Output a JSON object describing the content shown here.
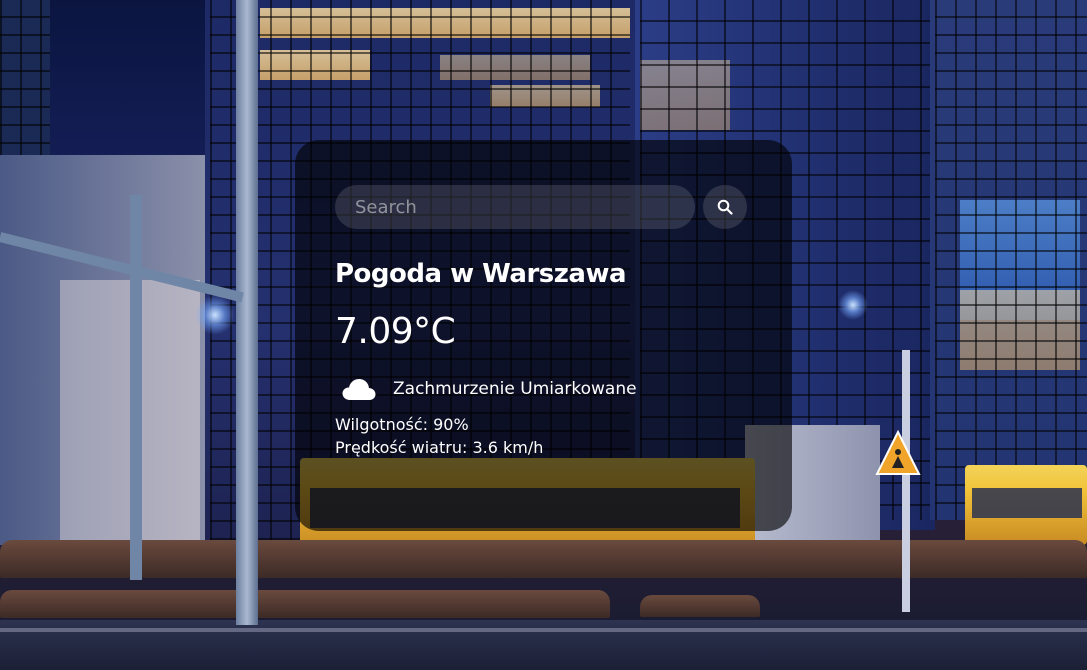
{
  "search": {
    "placeholder": "Search",
    "value": "",
    "button_icon": "search-icon"
  },
  "weather": {
    "title": "Pogoda w Warszawa",
    "temperature": "7.09°C",
    "condition_icon": "cloud-icon",
    "description": "Zachmurzenie Umiarkowane",
    "humidity": "Wilgotność: 90%",
    "wind": "Prędkość wiatru: 3.6 km/h"
  },
  "colors": {
    "card_background": "rgba(0,0,0,0.62)",
    "text": "#ffffff",
    "input_background": "rgba(235,235,235,0.14)"
  }
}
